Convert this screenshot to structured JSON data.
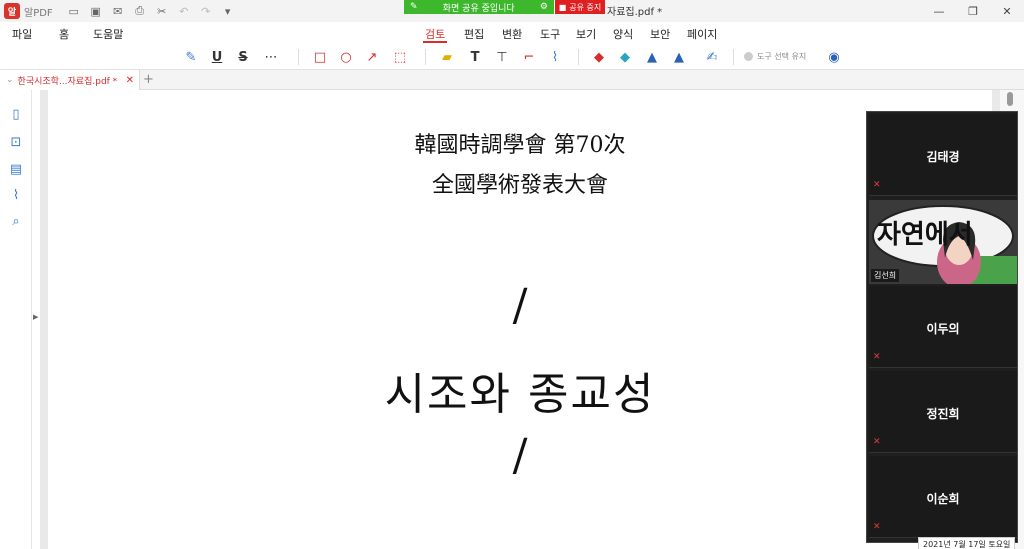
{
  "titlebar": {
    "app_name": "알PDF",
    "share_status": "화면 공유 중입니다",
    "stop_share": "공유 중지",
    "document_title": "자료집.pdf *"
  },
  "menu": {
    "left": [
      "파일",
      "홈",
      "도움말"
    ],
    "tabs": [
      "검토",
      "편집",
      "변환",
      "도구",
      "보기",
      "양식",
      "보안",
      "페이지"
    ],
    "active_tab": "검토"
  },
  "toolbar": {
    "keep_tool_label": "도구 선택 유지"
  },
  "tabs": {
    "file_tab": "한국시조학...자료집.pdf *",
    "new_tab": "+"
  },
  "document": {
    "title_line1": "韓國時調學會 第70次",
    "title_line2": "全國學術發表大會",
    "slash_top": "/",
    "main_title": "시조와 종교성",
    "slash_bottom": "/"
  },
  "participants": [
    {
      "name": "김태경"
    },
    {
      "name": "김선희"
    },
    {
      "name": "이두의"
    },
    {
      "name": "정진희"
    },
    {
      "name": "이순희"
    }
  ],
  "video": {
    "sign_text": "자연에서"
  },
  "date_stamp": "2021년 7월 17일 토요일",
  "colors": {
    "accent": "#d62d2d",
    "share_green": "#3db82d",
    "stop_red": "#e02020",
    "icon_blue": "#3a7bd5"
  }
}
